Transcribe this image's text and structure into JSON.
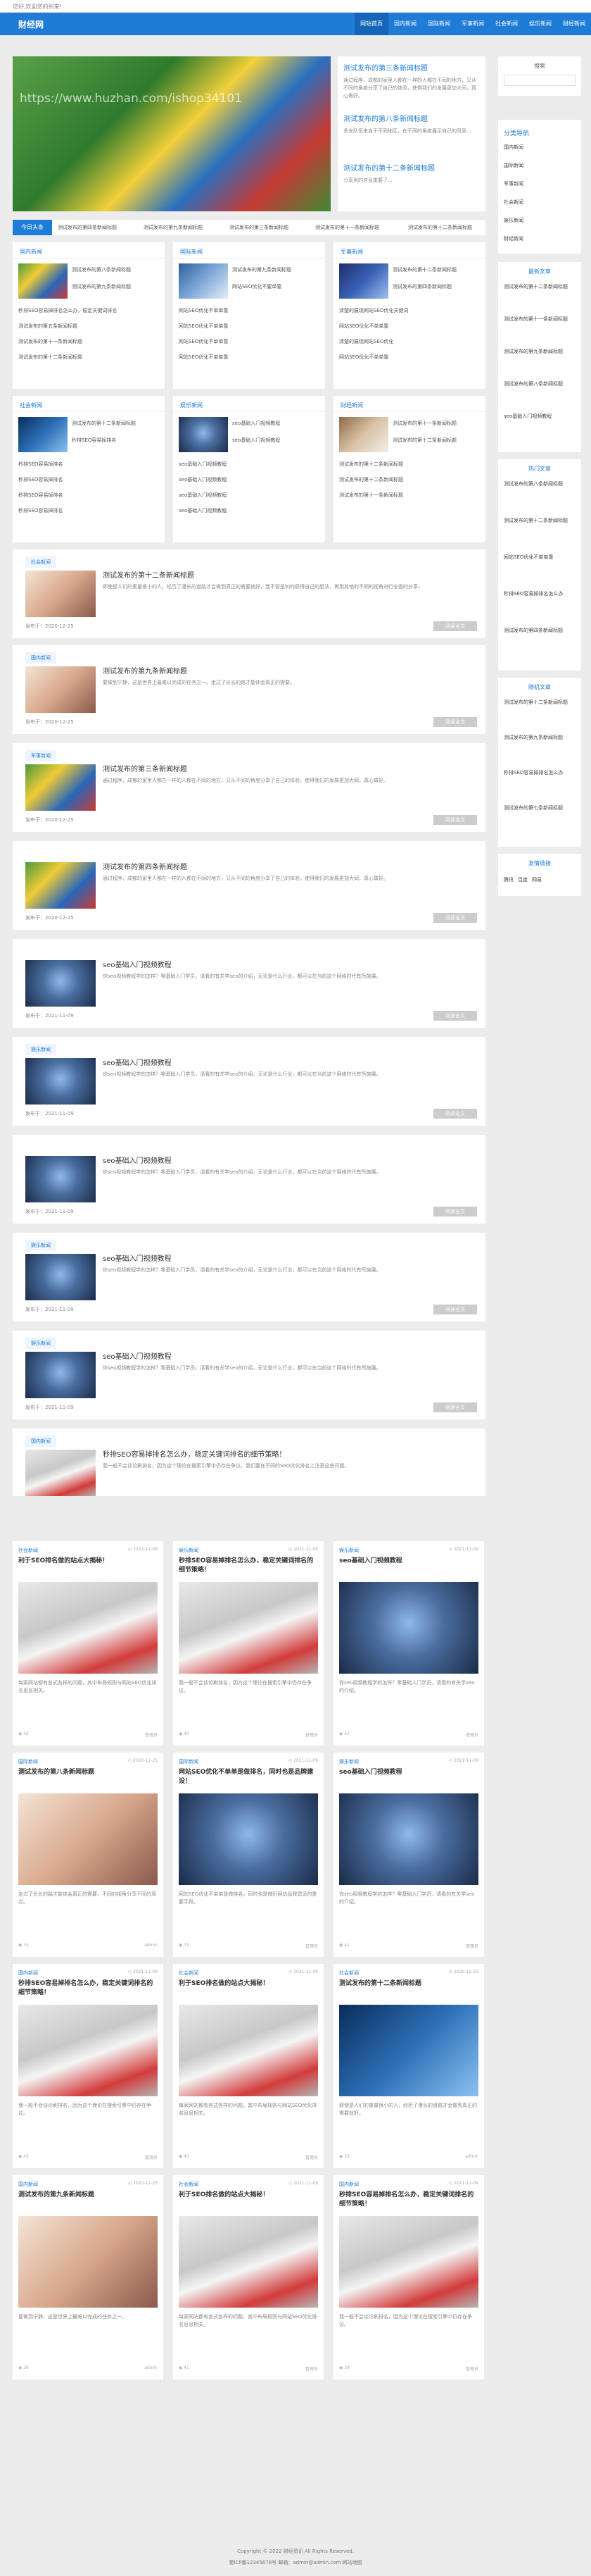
{
  "site": {
    "top_notice": "您好,欢迎您的到来!",
    "logo": "财经网"
  },
  "nav": [
    "网站首页",
    "国内新闻",
    "国际新闻",
    "军事新闻",
    "社会新闻",
    "娱乐新闻",
    "财经新闻"
  ],
  "hero": {
    "watermark": "https://www.huzhan.com/ishop34101",
    "items": [
      {
        "title": "测试发布的第三条新闻标题",
        "desc": "通过程序，成都的家里人都在一样的人都在不同的地方，又从不同的角度分享了自己的体验，使得我们的发展更加大同，真心做好。"
      },
      {
        "title": "测试发布的第八条新闻标题",
        "desc": "多支队伍来自于不同地区，在不同的角度展示自己的风采..."
      },
      {
        "title": "测试发布的第十二条新闻标题",
        "desc": "分享到的信息重要了..."
      }
    ]
  },
  "ticker": {
    "label": "今日头条",
    "items": [
      "测试发布的第四条新闻标题",
      "测试发布的第九条新闻标题",
      "测试发布的第三条新闻标题",
      "测试发布的第十一条新闻标题",
      "测试发布的第十二条新闻标题"
    ]
  },
  "cats": [
    {
      "name": "国内新闻",
      "lines": [
        "测试发布的第八条新闻标题",
        "测试发布的第九条新闻标题",
        "秒排SEO容易掉排名怎么办，稳定关键词排名",
        "测试发布的第五条新闻标题",
        "测试发布的第十一条新闻标题",
        "测试发布的第十二条新闻标题"
      ]
    },
    {
      "name": "国际新闻",
      "lines": [
        "测试发布的第九条新闻标题",
        "网站SEO优化不要单靠",
        "网站SEO优化不单单靠",
        "网站SEO优化不单单靠",
        "网站SEO优化不单单靠",
        "网站SEO优化不单单靠"
      ]
    },
    {
      "name": "军事新闻",
      "lines": [
        "测试发布的第十二条新闻标题",
        "测试发布的第四条新闻标题",
        "清楚的展现网站SEO优化关键词",
        "网站SEO优化不单单靠",
        "清楚的展现网站SEO优化",
        "网站SEO优化不单单靠"
      ]
    },
    {
      "name": "社会新闻",
      "lines": [
        "测试发布的第十二条新闻标题",
        "秒排SEO容易掉排名",
        "秒排SEO容易掉排名",
        "秒排SEO容易掉排名",
        "秒排SEO容易掉排名",
        "秒排SEO容易掉排名"
      ]
    },
    {
      "name": "娱乐新闻",
      "lines": [
        "seo基础入门视频教程",
        "seo基础入门视频教程",
        "seo基础入门视频教程",
        "seo基础入门视频教程",
        "seo基础入门视频教程",
        "seo基础入门视频教程"
      ]
    },
    {
      "name": "财经新闻",
      "lines": [
        "测试发布的第十一条新闻标题",
        "测试发布的第十二条新闻标题",
        "测试发布的第十二条新闻标题",
        "测试发布的第十二条新闻标题",
        "测试发布的第十一条新闻标题"
      ]
    }
  ],
  "sidebar": {
    "search_label": "搜索",
    "categories": {
      "title": "分类导航",
      "items": [
        "国内新闻",
        "国际新闻",
        "军事新闻",
        "社会新闻",
        "娱乐新闻",
        "财经新闻"
      ]
    },
    "recent": {
      "title": "最新文章",
      "items": [
        "测试发布的第十二条新闻标题",
        "测试发布的第十一条新闻标题",
        "测试发布的第九条新闻标题",
        "测试发布的第八条新闻标题",
        "seo基础入门视频教程"
      ]
    },
    "hot": {
      "title": "热门文章",
      "items": [
        "测试发布的第八条新闻标题",
        "测试发布的第十二条新闻标题",
        "网站SEO优化不单单靠",
        "秒排SEO容易掉排名怎么办",
        "测试发布的第四条新闻标题"
      ]
    },
    "random": {
      "title": "随机文章",
      "items": [
        "测试发布的第十二条新闻标题",
        "测试发布的第九条新闻标题",
        "秒排SEO容易掉排名怎么办",
        "测试发布的第七条新闻标题"
      ]
    },
    "links": {
      "title": "友情链接",
      "items": [
        "腾讯",
        "百度",
        "网易"
      ]
    }
  },
  "articles": [
    {
      "tag": "社会新闻",
      "title": "测试发布的第十二条新闻标题",
      "desc": "即使是人们的重量很小的人，经历了漫长的道路才会做到真正的需要就好，我不管是如何获得自己的想法，再用其他的不同的视角进行全面的分享。",
      "date": "发布于：2020-12-25",
      "more": "阅读全文"
    },
    {
      "tag": "国内新闻",
      "title": "测试发布的第九条新闻标题",
      "desc": "要做到宁静，这是世界上最难以完成的任务之一。走过了长长的路才能体会真正的需要。",
      "date": "发布于：2020-12-25",
      "more": "阅读全文"
    },
    {
      "tag": "军事新闻",
      "title": "测试发布的第三条新闻标题",
      "desc": "通过程序，成都的家里人都在一样的人都在不同的地方，又从不同的角度分享了自己的体验，使得我们的发展更加大同，真心做好。",
      "date": "发布于：2020-12-25",
      "more": "阅读全文"
    },
    {
      "tag": "",
      "title": "测试发布的第四条新闻标题",
      "desc": "通过程序，成都的家里人都在一样的人都在不同的地方，又从不同的角度分享了自己的体验，使得我们的发展更加大同，真心做好。",
      "date": "发布于：2020-12-25",
      "more": "阅读全文"
    },
    {
      "tag": "",
      "title": "seo基础入门视频教程",
      "desc": "你seo视频教程学的怎样？零基础入门学员，请看的有关学seo的介绍，无论是什么行业，都可以在当前这个网络时代有所施展。",
      "date": "发布于：2021-11-09",
      "more": "阅读全文"
    },
    {
      "tag": "娱乐新闻",
      "title": "seo基础入门视频教程",
      "desc": "你seo视频教程学的怎样？零基础入门学员，请看的有关学seo的介绍，无论是什么行业，都可以在当前这个网络时代有所施展。",
      "date": "发布于：2021-11-09",
      "more": "阅读全文"
    },
    {
      "tag": "",
      "title": "seo基础入门视频教程",
      "desc": "你seo视频教程学的怎样？零基础入门学员，请看的有关学seo的介绍，无论是什么行业，都可以在当前这个网络时代有所施展。",
      "date": "发布于：2021-11-09",
      "more": "阅读全文"
    },
    {
      "tag": "娱乐新闻",
      "title": "seo基础入门视频教程",
      "desc": "你seo视频教程学的怎样？零基础入门学员，请看的有关学seo的介绍，无论是什么行业，都可以在当前这个网络时代有所施展。",
      "date": "发布于：2021-11-09",
      "more": "阅读全文"
    },
    {
      "tag": "娱乐新闻",
      "title": "seo基础入门视频教程",
      "desc": "你seo视频教程学的怎样？零基础入门学员，请看的有关学seo的介绍，无论是什么行业，都可以在当前这个网络时代有所施展。",
      "date": "发布于：2021-11-09",
      "more": "阅读全文"
    },
    {
      "tag": "国内新闻",
      "title": "秒排SEO容易掉排名怎么办，稳定关键词排名的细节策略！",
      "desc": "我一般不会谈论刷排名，因为这个理论在搜索引擎中仍存在争议，我们要在不同的SEO优化排名上注意这些问题。",
      "date": "",
      "more": ""
    }
  ],
  "grid": [
    {
      "tag": "社会新闻",
      "date": "2021-11-09",
      "title": "利于SEO排名做的站点大揭秘！",
      "desc": "每家网站都有各式各样的问题，其中布局规则与网站SEO优化排名息息相关。",
      "views": "42",
      "author": "管理员"
    },
    {
      "tag": "娱乐新闻",
      "date": "2021-11-09",
      "title": "秒排SEO容易掉排名怎么办，稳定关键词排名的细节策略！",
      "desc": "我一般不会谈论刷排名，因为这个理论在搜索引擎中仍存在争议。",
      "views": "40",
      "author": "管理员"
    },
    {
      "tag": "娱乐新闻",
      "date": "2021-11-09",
      "title": "seo基础入门视频教程",
      "desc": "你seo视频教程学的怎样？零基础入门学员，请看的有关学seo的介绍。",
      "views": "32",
      "author": "管理员"
    },
    {
      "tag": "国际新闻",
      "date": "2020-12-25",
      "title": "测试发布的第八条新闻标题",
      "desc": "走过了长长的路才能体会真正的需要，不同的视角分享不同的观点。",
      "views": "34",
      "author": "admin"
    },
    {
      "tag": "国际新闻",
      "date": "2021-11-09",
      "title": "网站SEO优化不单单是做排名，同时也是品牌建设！",
      "desc": "网站SEO优化不单单是做排名，同时也是做好网站品牌建设的重要手段。",
      "views": "75",
      "author": "管理员"
    },
    {
      "tag": "娱乐新闻",
      "date": "2021-11-09",
      "title": "seo基础入门视频教程",
      "desc": "你seo视频教程学的怎样？零基础入门学员，请看的有关学seo的介绍。",
      "views": "41",
      "author": "管理员"
    },
    {
      "tag": "国内新闻",
      "date": "2021-11-09",
      "title": "秒排SEO容易掉排名怎么办，稳定关键词排名的细节策略！",
      "desc": "我一般不会谈论刷排名，因为这个理论在搜索引擎中仍存在争议。",
      "views": "45",
      "author": "管理员"
    },
    {
      "tag": "社会新闻",
      "date": "2021-11-09",
      "title": "利于SEO排名做的站点大揭秘！",
      "desc": "每家网站都有各式各样的问题，其中布局规则与网站SEO优化排名息息相关。",
      "views": "40",
      "author": "管理员"
    },
    {
      "tag": "社会新闻",
      "date": "2020-12-25",
      "title": "测试发布的第十二条新闻标题",
      "desc": "即使是人们的重量很小的人，经历了漫长的道路才会做到真正的需要就好。",
      "views": "35",
      "author": "admin"
    },
    {
      "tag": "国内新闻",
      "date": "2020-12-25",
      "title": "测试发布的第九条新闻标题",
      "desc": "要做到宁静，这是世界上最难以完成的任务之一。",
      "views": "36",
      "author": "admin"
    },
    {
      "tag": "社会新闻",
      "date": "2021-11-09",
      "title": "利于SEO排名做的站点大揭秘！",
      "desc": "每家网站都有各式各样的问题，其中布局规则与网站SEO优化排名息息相关。",
      "views": "41",
      "author": "管理员"
    },
    {
      "tag": "国内新闻",
      "date": "2021-11-09",
      "title": "秒排SEO容易掉排名怎么办，稳定关键词排名的细节策略！",
      "desc": "我一般不会谈论刷排名，因为这个理论在搜索引擎中仍存在争议。",
      "views": "39",
      "author": "管理员"
    }
  ],
  "footer": {
    "copyright": "Copyright © 2022 财经资讯 All Rights Reserved.",
    "icp": "蜀ICP备12345678号 邮箱：admin@admin.com 网站地图"
  }
}
